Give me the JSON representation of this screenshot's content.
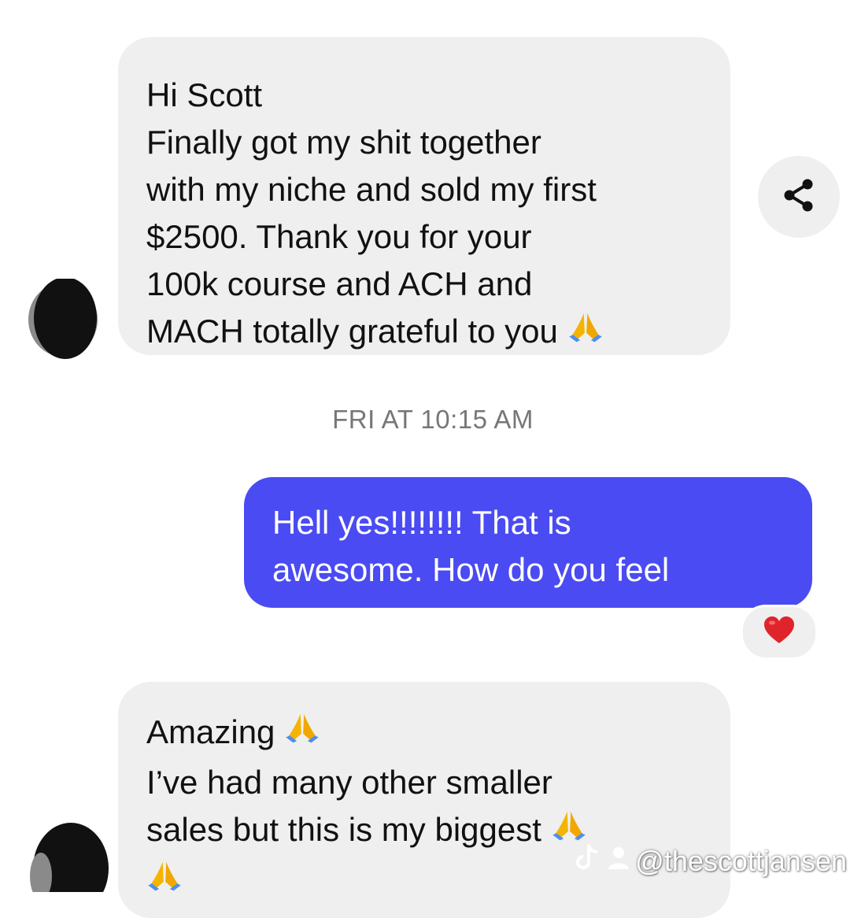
{
  "messages": [
    {
      "sender": "contact",
      "lines": [
        "Hi Scott",
        "Finally got my shit together",
        "with my niche and sold my first",
        "$2500. Thank you for your",
        "100k course and ACH and",
        "MACH totally grateful to you"
      ],
      "end_emoji": "folded-hands"
    },
    {
      "sender": "me",
      "lines": [
        "Hell yes!!!!!!!! That is",
        "awesome. How do you feel"
      ],
      "reaction": "red-heart"
    },
    {
      "sender": "contact",
      "lines": [
        "Amazing",
        "I’ve had many other smaller",
        "sales but this is my biggest"
      ]
    }
  ],
  "timestamp": "FRI AT 10:15 AM",
  "watermark": "@thescottjansen",
  "icons": [
    "share-icon",
    "avatar",
    "folded-hands-emoji",
    "heart-emoji",
    "tiktok-logo"
  ],
  "colors": {
    "incoming_bubble": "#efefef",
    "outgoing_bubble": "#4a4bf2",
    "timestamp_text": "#777777",
    "heart": "#e0242b"
  }
}
